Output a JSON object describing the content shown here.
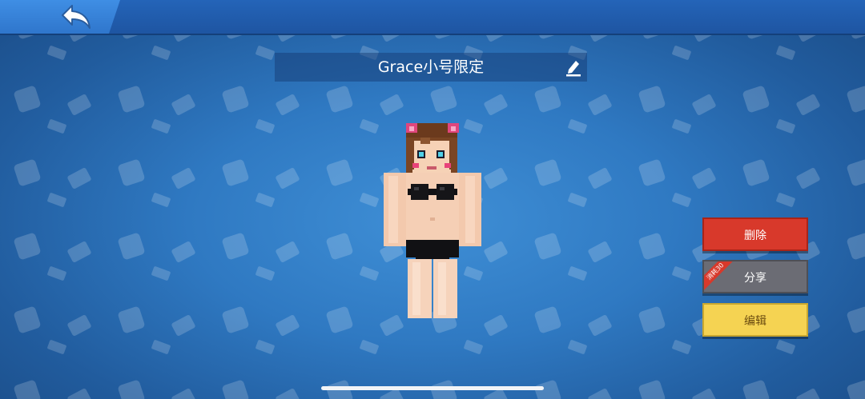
{
  "skin": {
    "name": "Grace小号限定"
  },
  "actions": {
    "delete_label": "删除",
    "share_label": "分享",
    "share_ribbon": "消耗30",
    "edit_label": "编辑"
  },
  "icons": {
    "back": "back-arrow-icon",
    "rename": "pencil-icon"
  },
  "colors": {
    "delete": "#d8392b",
    "share": "#6b6c74",
    "edit": "#f5d352",
    "topbar": "#1e55a2"
  }
}
